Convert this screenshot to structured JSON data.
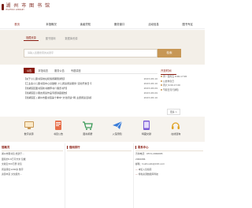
{
  "header": {
    "logo_cn": "湖 州 市 图 书 馆",
    "logo_en": "HUZHOU LIBRARY"
  },
  "nav": {
    "items": [
      "首页",
      "本馆概况",
      "读者须知",
      "服务窗口",
      "活动信息",
      "图书专区"
    ],
    "active_index": 0
  },
  "search": {
    "tabs": [
      "馆藏资源",
      "图书馆网",
      "数据库资源"
    ],
    "active_index": 0,
    "placeholder": "请输入您要搜索的关键字",
    "button_label": "检索"
  },
  "news": {
    "tabs": [
      "公告",
      "本馆动态",
      "服务公告",
      "专题讲座"
    ],
    "active_index": 0,
    "items": [
      {
        "title": "【关于小儿童书馆地址和借阅期限通知】",
        "date": "2023-08-10"
      },
      {
        "title": "【工业会小儿童书馆中心基础楼 少儿阅读阅读服务“活动开放日”】",
        "date": "2023-08-10"
      },
      {
        "title": "【滨湖馆区图书馆新书推荐书介展览书刊】",
        "date": "2023-08-09"
      },
      {
        "title": "【滨湖馆区小朋友阅读作品专题讲座报告】",
        "date": "2023-08-09"
      },
      {
        "title": "【滨湖馆区 | 湖州市图书馆第十季中“文化阅读”网 主题阅读活动】",
        "date": "2023-08-10"
      }
    ]
  },
  "hours": {
    "title": "开放时间",
    "lines": [
      "周一至周五 9:00-17:00",
      "公益休息日",
      "周六  9:00-17:00",
      "节假日另行通知"
    ],
    "more_label": "更多 >"
  },
  "services": [
    {
      "label": "数字资源",
      "icon": "screen-icon"
    },
    {
      "label": "书目公告",
      "icon": "book-icon"
    },
    {
      "label": "图书捐赠",
      "icon": "cart-icon"
    },
    {
      "label": "入馆须知",
      "icon": "paper-plane-icon"
    },
    {
      "label": "特藏文献",
      "icon": "tablet-icon"
    },
    {
      "label": "在线咨询",
      "icon": "headset-icon"
    }
  ],
  "cols": {
    "intro_title": "馆概况",
    "intro_lines": [
      "湖州市图书馆 始建于…",
      "面积约5.8万平方米 馆藏",
      "文献近300万册 新馆",
      "阅读座位1200余 数字",
      "资源丰富 文化服务…"
    ],
    "ranking_title": "借阅排行",
    "contact_title": "联系中心",
    "contact_lines": [
      "咨询电话：0572-2066085",
      "2066086",
      "邮箱：huzhoulib@163.com"
    ],
    "links": [
      "本馆入馆指南",
      "特色资源数据库导航"
    ]
  },
  "colors": {
    "brand": "#8a1c11",
    "accent": "#c79755"
  }
}
